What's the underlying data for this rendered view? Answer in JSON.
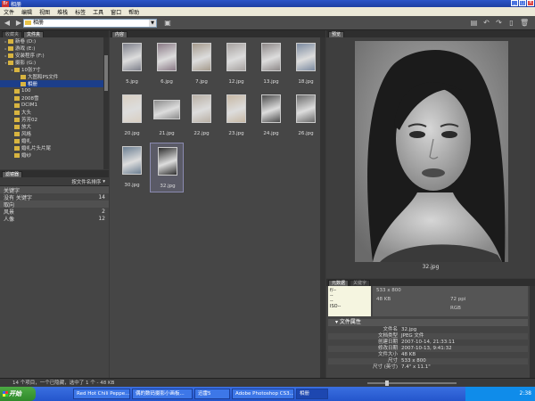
{
  "window": {
    "title": "相册",
    "app_badge": "Br"
  },
  "menu": [
    "文件",
    "编辑",
    "视图",
    "堆栈",
    "标签",
    "工具",
    "窗口",
    "帮助"
  ],
  "toolbar": {
    "path": "相册"
  },
  "panels": {
    "folders_tabs": [
      "收藏夹",
      "文件夹"
    ],
    "content_tab": "内容",
    "preview_tab": "预览",
    "filter_tab": "滤镜器",
    "meta_tabs": [
      "元数据",
      "关键字"
    ]
  },
  "folders": [
    {
      "label": "新卷 (D:)",
      "indent": 0,
      "tri": "▸"
    },
    {
      "label": "游戏 (E:)",
      "indent": 0,
      "tri": "▸"
    },
    {
      "label": "安装程序 (F:)",
      "indent": 0,
      "tri": "▸"
    },
    {
      "label": "摄影 (G:)",
      "indent": 0,
      "tri": "▾"
    },
    {
      "label": "10张7寸",
      "indent": 1,
      "tri": "▾"
    },
    {
      "label": "大图和PS文件",
      "indent": 2,
      "tri": ""
    },
    {
      "label": "相册",
      "indent": 2,
      "tri": "",
      "selected": true
    },
    {
      "label": "100",
      "indent": 1,
      "tri": ""
    },
    {
      "label": "2008雪",
      "indent": 1,
      "tri": ""
    },
    {
      "label": "DCIM1",
      "indent": 1,
      "tri": ""
    },
    {
      "label": "大头",
      "indent": 1,
      "tri": ""
    },
    {
      "label": "芳芳02",
      "indent": 1,
      "tri": ""
    },
    {
      "label": "放大",
      "indent": 1,
      "tri": ""
    },
    {
      "label": "风格",
      "indent": 1,
      "tri": ""
    },
    {
      "label": "婚礼",
      "indent": 1,
      "tri": ""
    },
    {
      "label": "婚礼片头片尾",
      "indent": 1,
      "tri": ""
    },
    {
      "label": "婚纱",
      "indent": 1,
      "tri": ""
    }
  ],
  "filter": {
    "sort_label": "按文件名排序",
    "rows": [
      {
        "label": "关键字",
        "count": "",
        "cat": true
      },
      {
        "label": "没有 关键字",
        "count": "14",
        "cat": false
      },
      {
        "label": "取向",
        "count": "",
        "cat": true
      },
      {
        "label": "风景",
        "count": "2",
        "cat": false
      },
      {
        "label": "人像",
        "count": "12",
        "cat": false
      }
    ]
  },
  "thumbnails": [
    {
      "name": "5.jpg",
      "land": false,
      "tone": "#7d7f8a"
    },
    {
      "name": "6.jpg",
      "land": false,
      "tone": "#8a7a86"
    },
    {
      "name": "7.jpg",
      "land": false,
      "tone": "#a59a8c"
    },
    {
      "name": "12.jpg",
      "land": false,
      "tone": "#a7a2a0"
    },
    {
      "name": "13.jpg",
      "land": false,
      "tone": "#8d8888"
    },
    {
      "name": "18.jpg",
      "land": false,
      "tone": "#7b8aa0"
    },
    {
      "name": "20.jpg",
      "land": false,
      "tone": "#d9cfc2"
    },
    {
      "name": "21.jpg",
      "land": true,
      "tone": "#8c8c8c"
    },
    {
      "name": "22.jpg",
      "land": false,
      "tone": "#b9b0a5"
    },
    {
      "name": "23.jpg",
      "land": false,
      "tone": "#c7b8a4"
    },
    {
      "name": "24.jpg",
      "land": false,
      "tone": "#4c4c4c"
    },
    {
      "name": "26.jpg",
      "land": false,
      "tone": "#6a6a6a"
    },
    {
      "name": "30.jpg",
      "land": false,
      "tone": "#6c7f92"
    },
    {
      "name": "32.jpg",
      "land": false,
      "tone": "#2e2e2e",
      "selected": true
    }
  ],
  "preview": {
    "caption": "32.jpg"
  },
  "meta": {
    "card1": [
      "f/--",
      "--",
      "--",
      "ISO--"
    ],
    "card2": [
      "533 x 800",
      "",
      "48 KB",
      "72 ppi",
      "",
      "RGB"
    ],
    "section_title": "文件属性",
    "rows": [
      {
        "k": "文件名",
        "v": "32.jpg"
      },
      {
        "k": "文档类型",
        "v": "JPEG 文件"
      },
      {
        "k": "创建日期",
        "v": "2007-10-14, 21:33:11"
      },
      {
        "k": "修改日期",
        "v": "2007-10-13, 9:41:32"
      },
      {
        "k": "文件大小",
        "v": "48 KB"
      },
      {
        "k": "尺寸",
        "v": "533 x 800"
      },
      {
        "k": "尺寸 (英寸)",
        "v": "7.4\" x 11.1\""
      }
    ]
  },
  "status": {
    "text": "14 个项目，一个已隐藏，选中了 1 个 - 48 KB"
  },
  "taskbar": {
    "start": "开始",
    "tasks": [
      "Red Hot Chili Peppe...",
      "偶的数码摄影小画板...",
      "迅雷5",
      "Adobe Photoshop CS3...",
      "相册"
    ],
    "clock": "2:38"
  }
}
